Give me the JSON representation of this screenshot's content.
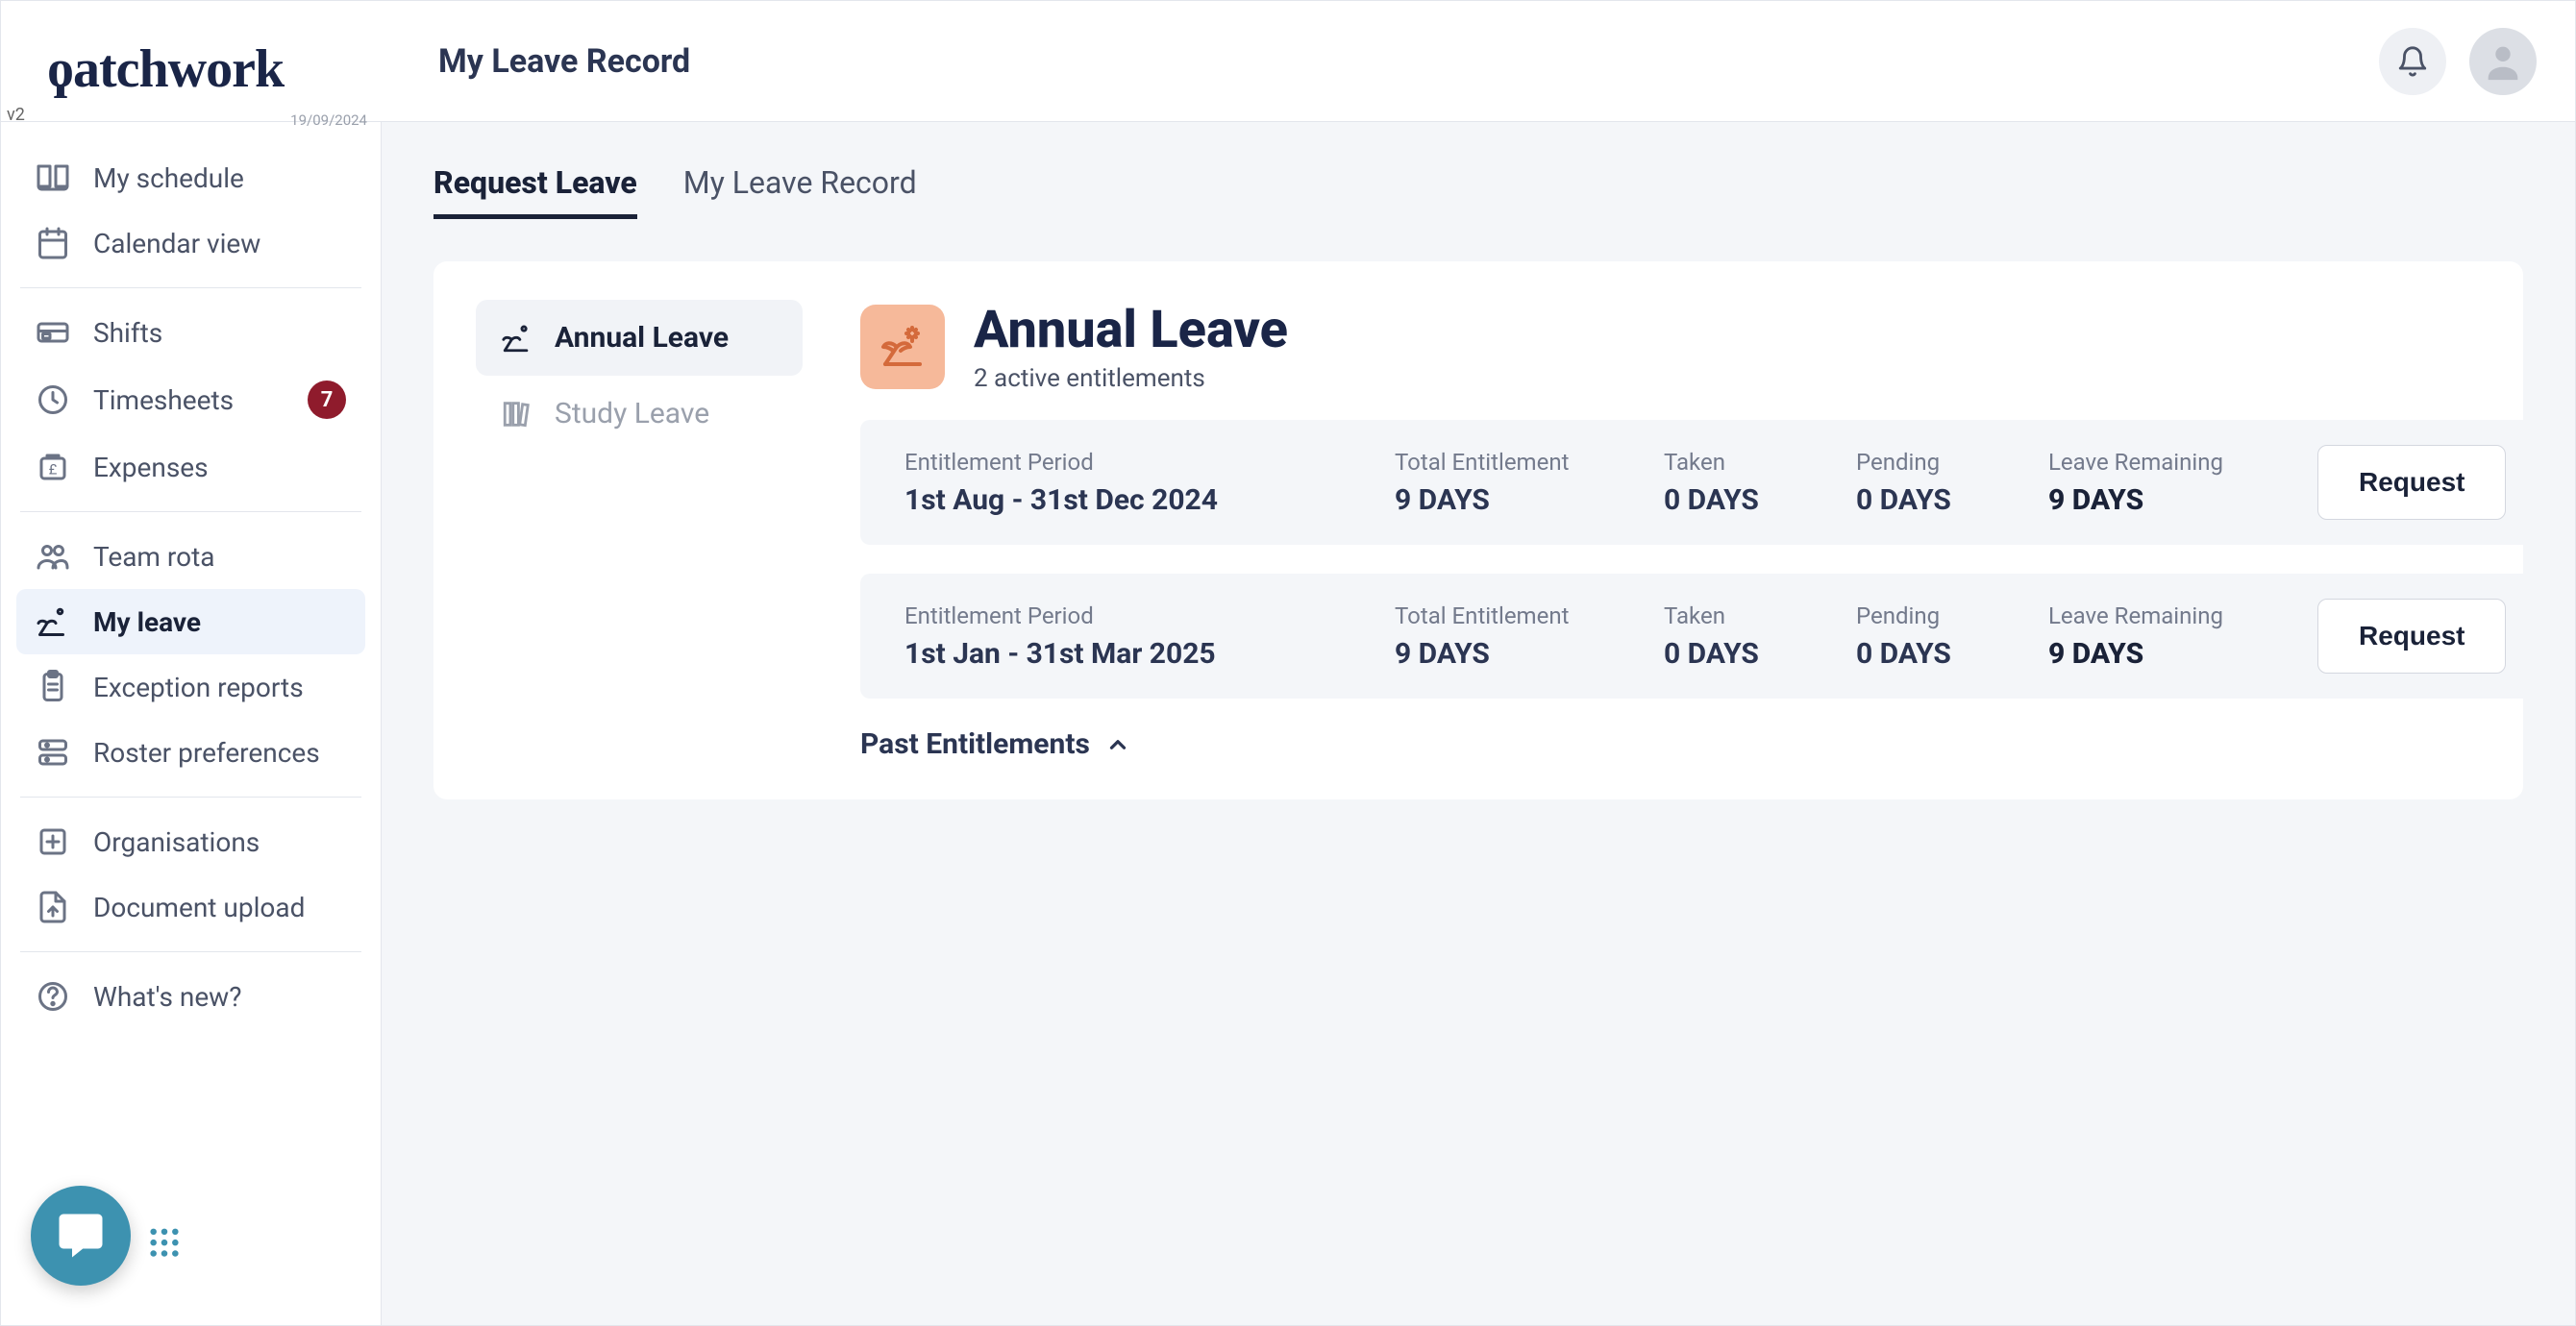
{
  "app": {
    "logo": "Patchwork",
    "version": "v2",
    "build_date": "19/09/2024"
  },
  "header": {
    "title": "My Leave Record"
  },
  "sidebar": {
    "groups": [
      {
        "items": [
          {
            "id": "my-schedule",
            "label": "My schedule"
          },
          {
            "id": "calendar-view",
            "label": "Calendar view"
          }
        ]
      },
      {
        "items": [
          {
            "id": "shifts",
            "label": "Shifts"
          },
          {
            "id": "timesheets",
            "label": "Timesheets",
            "badge": "7"
          },
          {
            "id": "expenses",
            "label": "Expenses"
          }
        ]
      },
      {
        "items": [
          {
            "id": "team-rota",
            "label": "Team rota"
          },
          {
            "id": "my-leave",
            "label": "My leave",
            "active": true
          },
          {
            "id": "exception-reports",
            "label": "Exception reports"
          },
          {
            "id": "roster-preferences",
            "label": "Roster preferences"
          }
        ]
      },
      {
        "items": [
          {
            "id": "organisations",
            "label": "Organisations"
          },
          {
            "id": "document-upload",
            "label": "Document upload"
          }
        ]
      },
      {
        "items": [
          {
            "id": "whats-new",
            "label": "What's new?"
          }
        ]
      }
    ]
  },
  "tabs": [
    {
      "id": "request-leave",
      "label": "Request Leave",
      "active": true
    },
    {
      "id": "my-leave-record",
      "label": "My Leave Record"
    }
  ],
  "leave_types": [
    {
      "id": "annual-leave",
      "label": "Annual Leave",
      "active": true
    },
    {
      "id": "study-leave",
      "label": "Study Leave"
    }
  ],
  "section": {
    "title": "Annual Leave",
    "subtitle": "2 active entitlements",
    "past_toggle": "Past Entitlements",
    "columns": {
      "period": "Entitlement Period",
      "total": "Total Entitlement",
      "taken": "Taken",
      "pending": "Pending",
      "remaining": "Leave Remaining"
    },
    "request_label": "Request",
    "entitlements": [
      {
        "period": "1st Aug - 31st Dec 2024",
        "total": "9 DAYS",
        "taken": "0 DAYS",
        "pending": "0 DAYS",
        "remaining": "9 DAYS"
      },
      {
        "period": "1st Jan - 31st Mar 2025",
        "total": "9 DAYS",
        "taken": "0 DAYS",
        "pending": "0 DAYS",
        "remaining": "9 DAYS"
      }
    ]
  }
}
